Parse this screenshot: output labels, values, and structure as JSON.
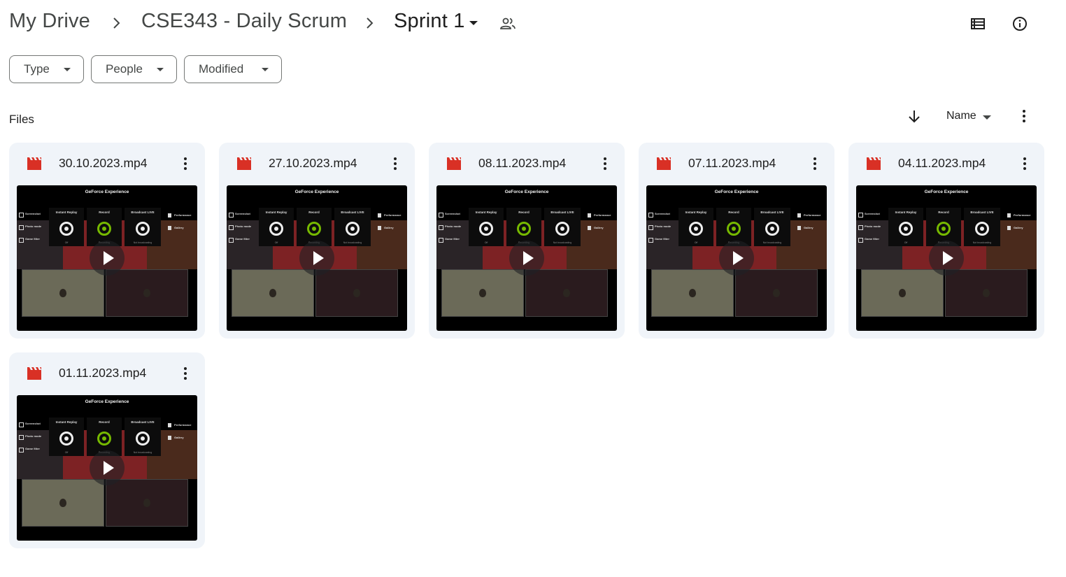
{
  "breadcrumb": {
    "items": [
      "My Drive",
      "CSE343 - Daily Scrum",
      "Sprint 1"
    ]
  },
  "toolbar": {
    "list_view_icon": "list-view-icon",
    "info_icon": "info-icon",
    "shared_icon": "people-icon"
  },
  "filters": [
    {
      "label": "Type"
    },
    {
      "label": "People"
    },
    {
      "label": "Modified"
    }
  ],
  "section": {
    "title": "Files",
    "sort_direction_icon": "arrow-down-icon",
    "sort_by": "Name"
  },
  "colors": {
    "card_bg": "#f0f4f9",
    "video_icon": "#d93025",
    "gfe_green": "#76b900"
  },
  "thumbnail_text": {
    "app_title": "GeForce Experience",
    "instant_replay": "Instant Replay",
    "record": "Record",
    "broadcast": "Broadcast LIVE",
    "screenshot": "Screenshot",
    "photo_mode": "Photo mode",
    "game_filter": "Game filter",
    "performance": "Performance",
    "gallery": "Gallery",
    "off": "Off",
    "recording": "Recording",
    "not_broadcasting": "Not broadcasting"
  },
  "files": [
    {
      "name": "30.10.2023.mp4",
      "icon": "video-file-icon"
    },
    {
      "name": "27.10.2023.mp4",
      "icon": "video-file-icon"
    },
    {
      "name": "08.11.2023.mp4",
      "icon": "video-file-icon"
    },
    {
      "name": "07.11.2023.mp4",
      "icon": "video-file-icon"
    },
    {
      "name": "04.11.2023.mp4",
      "icon": "video-file-icon"
    },
    {
      "name": "01.11.2023.mp4",
      "icon": "video-file-icon"
    }
  ]
}
